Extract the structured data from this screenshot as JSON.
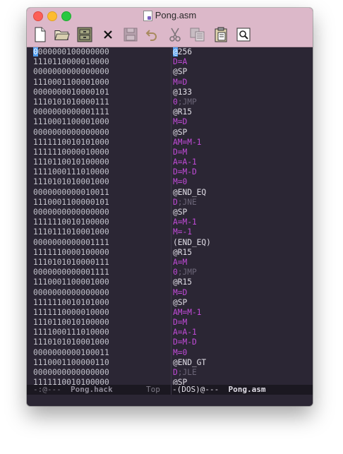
{
  "window": {
    "title": "Pong.asm"
  },
  "toolbar": {
    "buttons": [
      {
        "name": "new-file",
        "icon": "new-file-icon"
      },
      {
        "name": "open-file",
        "icon": "folder-open-icon"
      },
      {
        "name": "dired",
        "icon": "cabinet-icon"
      },
      {
        "name": "close",
        "icon": "close-icon"
      },
      {
        "name": "save",
        "icon": "floppy-icon"
      },
      {
        "name": "undo",
        "icon": "undo-icon"
      },
      {
        "name": "cut",
        "icon": "scissors-icon"
      },
      {
        "name": "copy",
        "icon": "copy-icon"
      },
      {
        "name": "paste",
        "icon": "paste-icon"
      },
      {
        "name": "search",
        "icon": "search-icon"
      }
    ]
  },
  "left_pane": {
    "lines": [
      "0000000100000000",
      "1110110000010000",
      "0000000000000000",
      "1110001100001000",
      "0000000010000101",
      "1110101010000111",
      "0000000000001111",
      "1110001100001000",
      "0000000000000000",
      "1111110010101000",
      "1111110000010000",
      "1110110010100000",
      "1111000111010000",
      "1110101010001000",
      "0000000000010011",
      "1110001100000101",
      "0000000000000000",
      "1111110010100000",
      "1110111010001000",
      "0000000000001111",
      "1111110000100000",
      "1110101010000111",
      "0000000000001111",
      "1110001100001000",
      "0000000000000000",
      "1111110010101000",
      "1111110000010000",
      "1110110010100000",
      "1111000111010000",
      "1110101010001000",
      "0000000000100011",
      "1110001100000110",
      "0000000000000000",
      "1111110010100000"
    ]
  },
  "right_pane": {
    "lines": [
      {
        "text": "@256",
        "kind": "addr"
      },
      {
        "text": "D=A",
        "kind": "comp"
      },
      {
        "text": "@SP",
        "kind": "addr"
      },
      {
        "text": "M=D",
        "kind": "comp"
      },
      {
        "text": "@133",
        "kind": "addr"
      },
      {
        "text": "0",
        "jump": ";JMP",
        "kind": "jump"
      },
      {
        "text": "@R15",
        "kind": "addr"
      },
      {
        "text": "M=D",
        "kind": "comp"
      },
      {
        "text": "@SP",
        "kind": "addr"
      },
      {
        "text": "AM=M-1",
        "kind": "comp"
      },
      {
        "text": "D=M",
        "kind": "comp"
      },
      {
        "text": "A=A-1",
        "kind": "comp"
      },
      {
        "text": "D=M-D",
        "kind": "comp"
      },
      {
        "text": "M=0",
        "kind": "comp"
      },
      {
        "text": "@END_EQ",
        "kind": "addr"
      },
      {
        "text": "D",
        "jump": ";JNE",
        "kind": "jump"
      },
      {
        "text": "@SP",
        "kind": "addr"
      },
      {
        "text": "A=M-1",
        "kind": "comp"
      },
      {
        "text": "M=-1",
        "kind": "comp"
      },
      {
        "text": "(END_EQ)",
        "kind": "label"
      },
      {
        "text": "@R15",
        "kind": "addr"
      },
      {
        "text": "A=M",
        "kind": "comp"
      },
      {
        "text": "0",
        "jump": ";JMP",
        "kind": "jump"
      },
      {
        "text": "@R15",
        "kind": "addr"
      },
      {
        "text": "M=D",
        "kind": "comp"
      },
      {
        "text": "@SP",
        "kind": "addr"
      },
      {
        "text": "AM=M-1",
        "kind": "comp"
      },
      {
        "text": "D=M",
        "kind": "comp"
      },
      {
        "text": "A=A-1",
        "kind": "comp"
      },
      {
        "text": "D=M-D",
        "kind": "comp"
      },
      {
        "text": "M=0",
        "kind": "comp"
      },
      {
        "text": "@END_GT",
        "kind": "addr"
      },
      {
        "text": "D",
        "jump": ";JLE",
        "kind": "jump"
      },
      {
        "text": "@SP",
        "kind": "addr"
      }
    ]
  },
  "modeline": {
    "left_status": "-:@---  ",
    "left_buffer": "Pong.hack",
    "left_position": "Top",
    "right_status": "-(DOS)@---  ",
    "right_buffer": "Pong.asm"
  },
  "colors": {
    "titlebar": "#dcb8c9",
    "editor_bg": "#2b2634",
    "keyword": "#c24bd9",
    "cursor": "#4f9df0"
  }
}
